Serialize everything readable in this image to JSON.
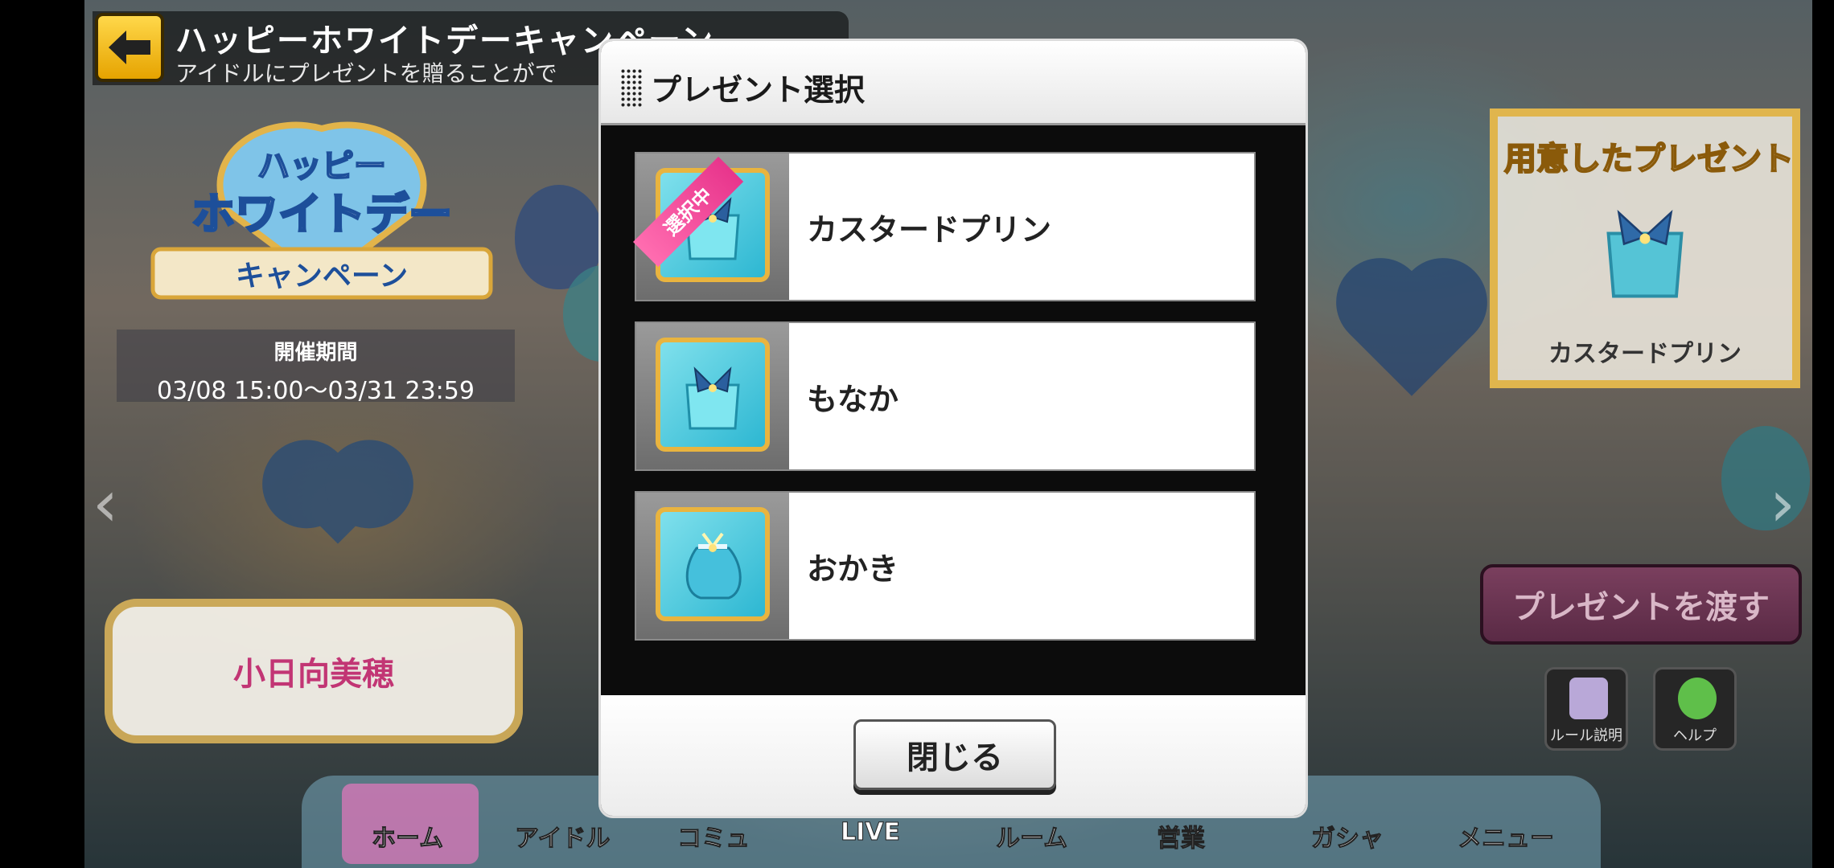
{
  "header": {
    "title": "ハッピーホワイトデーキャンペーン",
    "subtitle": "アイドルにプレゼントを贈ることがで"
  },
  "campaign": {
    "logo_line1": "ハッピー",
    "logo_line2": "ホワイトデー",
    "logo_line3": "キャンペーン",
    "period_label": "開催期間",
    "period_dates": "03/08 15:00〜03/31 23:59"
  },
  "idol": {
    "name": "小日向美穂"
  },
  "prepared_present": {
    "title": "用意したプレゼント",
    "item_name": "カスタードプリン"
  },
  "actions": {
    "give_present": "プレゼントを渡す",
    "rules": "ルール説明",
    "help": "ヘルプ"
  },
  "bottom_nav": {
    "items": [
      {
        "label": "ホーム"
      },
      {
        "label": "アイドル"
      },
      {
        "label": "コミュ"
      },
      {
        "label": "LIVE"
      },
      {
        "label": "ルーム"
      },
      {
        "label": "営業"
      },
      {
        "label": "ガシャ"
      },
      {
        "label": "メニュー"
      }
    ]
  },
  "modal": {
    "title": "プレゼント選択",
    "selected_badge": "選択中",
    "items": [
      {
        "name": "カスタードプリン",
        "icon": "gift-bag-icon",
        "selected": true
      },
      {
        "name": "もなか",
        "icon": "gift-bag-icon",
        "selected": false
      },
      {
        "name": "おかき",
        "icon": "gift-pouch-icon",
        "selected": false
      }
    ],
    "close_label": "閉じる"
  },
  "colors": {
    "accent_gold": "#e9b43f",
    "selected_pink": "#e8358c",
    "idol_name_pink": "#d0347a",
    "give_button": "#6a3350"
  }
}
